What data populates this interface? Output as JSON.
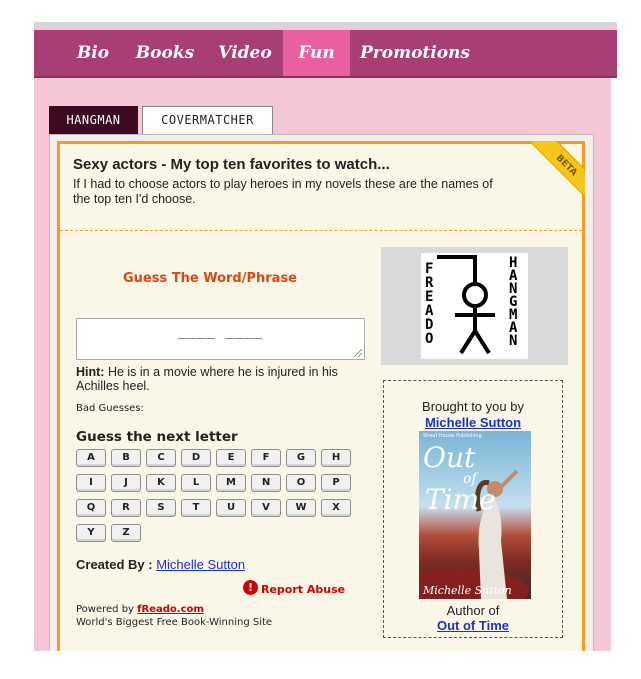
{
  "nav": {
    "items": [
      {
        "label": "Bio",
        "active": false
      },
      {
        "label": "Books",
        "active": false
      },
      {
        "label": "Video",
        "active": false
      },
      {
        "label": "Fun",
        "active": true
      },
      {
        "label": "Promotions",
        "active": false
      }
    ]
  },
  "tabs": [
    {
      "label": "HANGMAN",
      "active": true
    },
    {
      "label": "COVERMATCHER",
      "active": false
    }
  ],
  "game": {
    "badge": "BETA",
    "title": "Sexy actors - My top ten favorites to watch...",
    "description": "If I had to choose actors to play heroes in my novels these are the names of the top ten I'd choose.",
    "guess_heading": "Guess The Word/Phrase",
    "answer_display": "____  ____",
    "hint_label": "Hint:",
    "hint_text": "He is in a movie where he is injured in his Achilles heel.",
    "bad_guesses_label": "Bad Guesses:",
    "next_letter_label": "Guess the next letter",
    "letters": [
      "A",
      "B",
      "C",
      "D",
      "E",
      "F",
      "G",
      "H",
      "I",
      "J",
      "K",
      "L",
      "M",
      "N",
      "O",
      "P",
      "Q",
      "R",
      "S",
      "T",
      "U",
      "V",
      "W",
      "X",
      "Y",
      "Z"
    ],
    "created_by_label": "Created By :",
    "created_by_name": "Michelle Sutton",
    "report_abuse": "Report Abuse",
    "powered_by_label": "Powered by",
    "powered_by_link": "fReado.com",
    "powered_tagline": "World's Biggest Free Book-Winning Site"
  },
  "logo": {
    "left_text": "FREADO",
    "right_text": "HANGMAN"
  },
  "sponsor": {
    "brought_by": "Brought to you by",
    "name": "Michelle Sutton",
    "cover": {
      "title_top": "Out",
      "title_mid": "of",
      "title_bottom": "Time",
      "author": "Michelle Sutton",
      "tagline": "Sheaf House Publishing"
    },
    "author_of": "Author of",
    "book_title": "Out of Time"
  },
  "colors": {
    "nav_bg": "#a73f75",
    "nav_active": "#e8609f",
    "page_bg": "#f5c6d6",
    "game_border": "#f39a27",
    "heading_accent": "#d24a14",
    "link": "#1a32c8",
    "report": "#d40000"
  }
}
